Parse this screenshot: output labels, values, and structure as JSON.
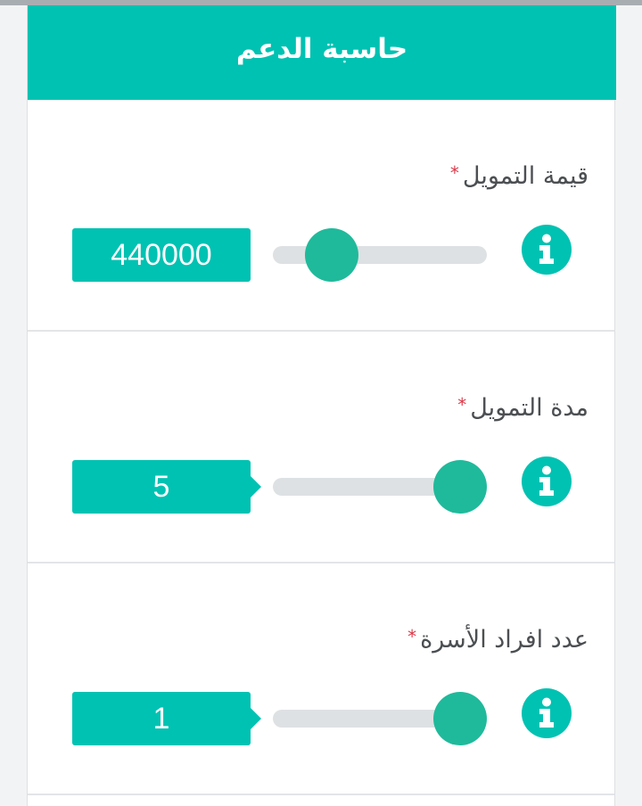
{
  "calculator": {
    "title": "حاسبة الدعم",
    "required_mark": "*",
    "fields": [
      {
        "label": "قيمة التمويل",
        "value": "440000",
        "slider_fraction": 0.2,
        "info_icon": "info-icon"
      },
      {
        "label": "مدة التمويل",
        "value": "5",
        "slider_fraction": 1.0,
        "info_icon": "info-icon"
      },
      {
        "label": "عدد افراد الأسرة",
        "value": "1",
        "slider_fraction": 1.0,
        "info_icon": "info-icon"
      }
    ]
  },
  "colors": {
    "accent": "#00c2b2",
    "thumb": "#1fba9b",
    "track": "#dde1e3",
    "required": "#d93a4a",
    "label_text": "#4c4f52"
  }
}
